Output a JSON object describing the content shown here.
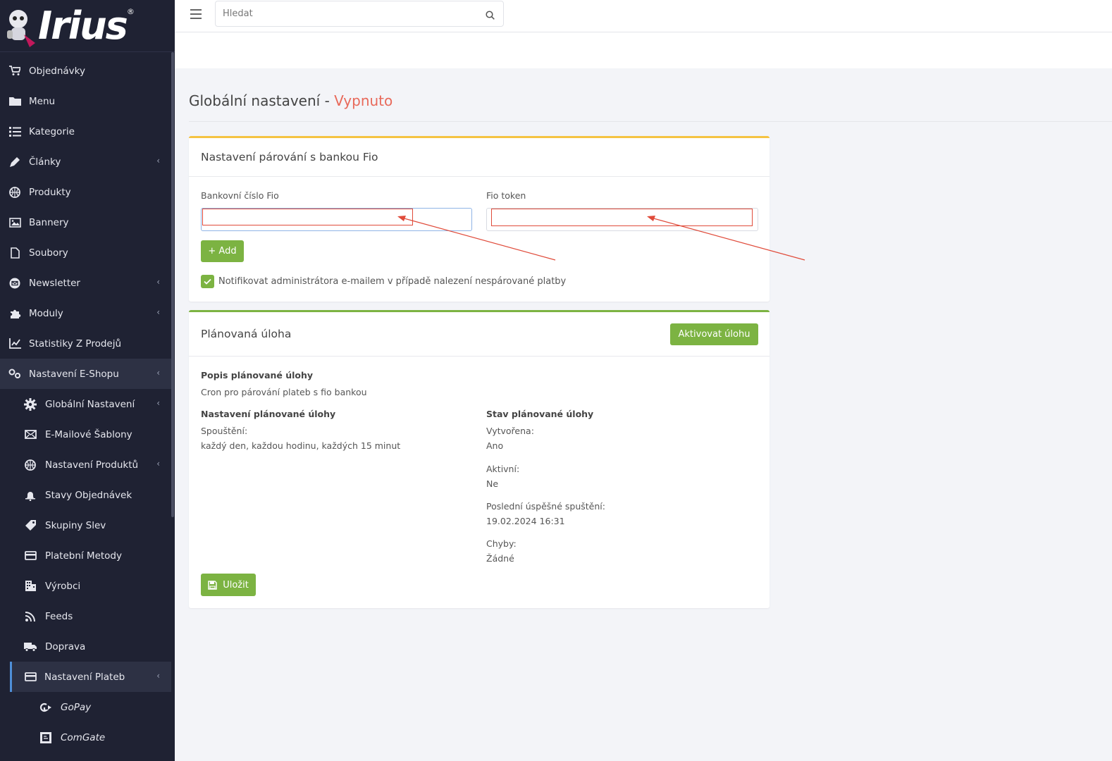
{
  "brand": {
    "logo_text": "Irius",
    "logo_mark": "®"
  },
  "search": {
    "placeholder": "Hledat"
  },
  "sidebar": {
    "items": [
      {
        "label": "Objednávky",
        "icon": "cart-icon"
      },
      {
        "label": "Menu",
        "icon": "folder-icon"
      },
      {
        "label": "Kategorie",
        "icon": "list-icon"
      },
      {
        "label": "Články",
        "icon": "pencil-icon"
      },
      {
        "label": "Produkty",
        "icon": "basketball-icon"
      },
      {
        "label": "Bannery",
        "icon": "image-icon"
      },
      {
        "label": "Soubory",
        "icon": "file-icon"
      },
      {
        "label": "Newsletter",
        "icon": "newsletter-icon"
      },
      {
        "label": "Moduly",
        "icon": "puzzle-icon"
      },
      {
        "label": "Statistiky Z Prodejů",
        "icon": "chart-icon"
      },
      {
        "label": "Nastavení E-Shopu",
        "icon": "cogs-icon"
      },
      {
        "label": "Globální Nastavení",
        "icon": "gear-icon"
      },
      {
        "label": "E-Mailové Šablony",
        "icon": "envelope-icon"
      },
      {
        "label": "Nastavení Produktů",
        "icon": "basketball-icon"
      },
      {
        "label": "Stavy Objednávek",
        "icon": "bell-icon"
      },
      {
        "label": "Skupiny Slev",
        "icon": "tag-icon"
      },
      {
        "label": "Platební Metody",
        "icon": "credit-card-icon"
      },
      {
        "label": "Výrobci",
        "icon": "building-icon"
      },
      {
        "label": "Feeds",
        "icon": "rss-icon"
      },
      {
        "label": "Doprava",
        "icon": "truck-icon"
      },
      {
        "label": "Nastavení Plateb",
        "icon": "credit-card-icon"
      },
      {
        "label": "GoPay",
        "icon": "gopay-icon"
      },
      {
        "label": "ComGate",
        "icon": "comgate-icon"
      }
    ]
  },
  "page": {
    "title": "Globální nastavení - ",
    "status": "Vypnuto"
  },
  "fio": {
    "heading": "Nastavení párování s bankou Fio",
    "account_label": "Bankovní číslo Fio",
    "account_value": "",
    "token_label": "Fio token",
    "token_value": "",
    "add_label": "+ Add",
    "notify_label": "Notifikovat administrátora e-mailem v případě nalezení nespárované platby",
    "notify_checked": true
  },
  "task": {
    "heading": "Plánovaná úloha",
    "activate_label": "Aktivovat úlohu",
    "desc_title": "Popis plánované úlohy",
    "desc_text": "Cron pro párování plateb s fio bankou",
    "settings_title": "Nastavení plánované úlohy",
    "run_label": "Spouštění:",
    "run_value": "každý den, každou hodinu, každých 15 minut",
    "status_title": "Stav plánované úlohy",
    "created_label": "Vytvořena:",
    "created_value": "Ano",
    "active_label": "Aktivní:",
    "active_value": "Ne",
    "last_run_label": "Poslední úspěšné spuštění:",
    "last_run_value": "19.02.2024 16:31",
    "errors_label": "Chyby:",
    "errors_value": "Žádné",
    "save_label": "Uložit"
  },
  "colors": {
    "sidebar": "#1f2233",
    "accent_green": "#7cb342",
    "status_red": "#e8695a",
    "card1_top": "#f5c342",
    "annotation": "#e04b3a"
  }
}
